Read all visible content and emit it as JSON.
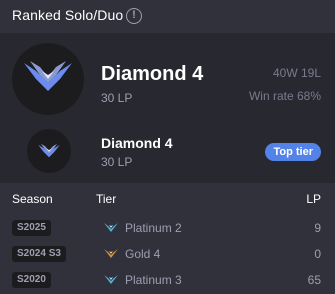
{
  "header": {
    "title": "Ranked Solo/Duo",
    "info_icon": "info-icon"
  },
  "current": {
    "tier": "Diamond 4",
    "lp": "30 LP",
    "wins_losses": "40W 19L",
    "win_rate": "Win rate 68%",
    "emblem_icon": "diamond-emblem-icon"
  },
  "peak": {
    "tier": "Diamond 4",
    "lp": "30 LP",
    "badge": "Top tier",
    "emblem_icon": "diamond-emblem-icon"
  },
  "table": {
    "headers": {
      "season": "Season",
      "tier": "Tier",
      "lp": "LP"
    },
    "rows": [
      {
        "season": "S2025",
        "tier": "Platinum 2",
        "lp": "9",
        "icon": "platinum-emblem-icon"
      },
      {
        "season": "S2024 S3",
        "tier": "Gold 4",
        "lp": "0",
        "icon": "gold-emblem-icon"
      },
      {
        "season": "S2020",
        "tier": "Platinum 3",
        "lp": "65",
        "icon": "platinum-emblem-icon"
      }
    ]
  },
  "colors": {
    "background": "#31313c",
    "card": "#282830",
    "accent": "#5383e8",
    "muted": "#9e9eb1",
    "platinum": "#4fb3d9",
    "gold": "#d9913a",
    "diamond": "#6c8cf0"
  }
}
